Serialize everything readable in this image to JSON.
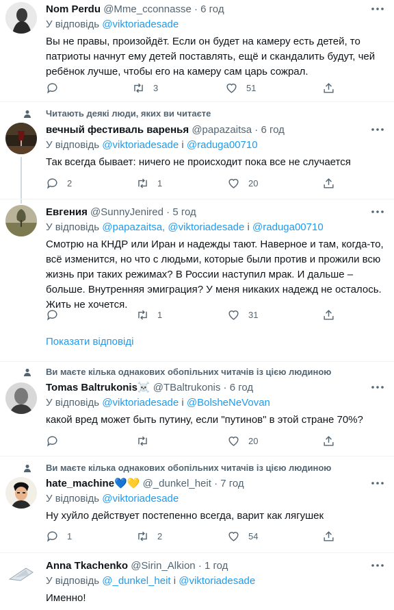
{
  "tweets": [
    {
      "name": "Nom Perdu",
      "handle": "@Mme_cconnasse",
      "time": "6 год",
      "reply_prefix": "У відповідь",
      "reply_links": [
        "@viktoriadesade"
      ],
      "reply_sep": "",
      "text": "Вы не правы, произойдёт. Если он будет на камеру есть детей, то патриоты начнут ему детей поставлять, ещё и скандалить будут, чей ребёнок лучше, чтобы его на камеру сам царь сожрал.",
      "replies": "",
      "retweets": "3",
      "likes": "51"
    },
    {
      "context": "Читають деякі люди, яких ви читаєте",
      "name": "вечный фестиваль варенья",
      "handle": "@papazaitsa",
      "time": "6 год",
      "reply_prefix": "У відповідь",
      "reply_links": [
        "@viktoriadesade",
        "@raduga00710"
      ],
      "reply_sep": "і",
      "text": "Так всегда бывает: ничего не происходит пока все не случается",
      "replies": "2",
      "retweets": "1",
      "likes": "20"
    },
    {
      "name": "Евгения",
      "handle": "@SunnyJenired",
      "time": "5 год",
      "reply_prefix": "У відповідь",
      "reply_links": [
        "@papazaitsa,",
        "@viktoriadesade",
        "@raduga00710"
      ],
      "reply_sep": "і",
      "text": "Смотрю на КНДР или Иран и надежды тают. Наверное и там, когда-то, всё изменится, но что с людьми, которые были против и прожили всю жизнь при таких режимах? В России наступил мрак. И дальше – больше. Внутренняя эмиграция? У меня никаких надежд не осталось. Жить не хочется.",
      "replies": "",
      "retweets": "1",
      "likes": "31",
      "show_replies": "Показати відповіді"
    },
    {
      "context": "Ви маєте кілька однакових обопільних читачів із цією людиною",
      "name": "Tomas Baltrukonis",
      "name_emoji": "☠️",
      "handle": "@TBaltrukonis",
      "time": "6 год",
      "reply_prefix": "У відповідь",
      "reply_links": [
        "@viktoriadesade",
        "@BolsheNeVovan"
      ],
      "reply_sep": "і",
      "text": "какой вред может быть путину, если \"путинов\" в этой стране 70%?",
      "replies": "",
      "retweets": "",
      "likes": "20"
    },
    {
      "context": "Ви маєте кілька однакових обопільних читачів із цією людиною",
      "name": "hate_machine",
      "name_emoji": "💙💛",
      "handle": "@_dunkel_heit",
      "time": "7 год",
      "reply_prefix": "У відповідь",
      "reply_links": [
        "@viktoriadesade"
      ],
      "reply_sep": "",
      "text": "Ну хуйло действует постепенно всегда, варит как лягушек",
      "replies": "1",
      "retweets": "2",
      "likes": "54"
    },
    {
      "name": "Anna Tkachenko",
      "handle": "@Sirin_Alkion",
      "time": "1 год",
      "reply_prefix": "У відповідь",
      "reply_links": [
        "@_dunkel_heit",
        "@viktoriadesade"
      ],
      "reply_sep": "і",
      "text": "Именно!",
      "replies": "",
      "retweets": "",
      "likes": ""
    }
  ],
  "colors": {
    "accent": "#1d9bf0",
    "muted": "#536471",
    "border": "#eff3f4"
  },
  "icons": [
    "more-icon",
    "reply-icon",
    "retweet-icon",
    "like-icon",
    "share-icon",
    "person-icon"
  ]
}
